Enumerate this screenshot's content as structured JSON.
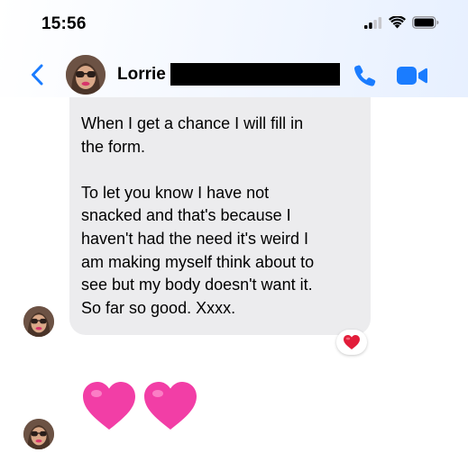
{
  "status_bar": {
    "time": "15:56",
    "icons": [
      "cellular-signal-icon",
      "wifi-icon",
      "battery-icon"
    ]
  },
  "header": {
    "back_icon": "chevron-left-icon",
    "contact_name": "Lorrie",
    "call_icon": "phone-icon",
    "video_icon": "video-camera-icon"
  },
  "messages": [
    {
      "sender": "Lorrie",
      "text": "When I get a chance I will fill in\nthe form.\n\nTo let you know I have not\nsnacked and that's because I\nhaven't had the need it's weird I\nam making myself think about  to\nsee but my body doesn't want it.\nSo far so good. Xxxx.",
      "reaction": "heart"
    },
    {
      "sender": "Lorrie",
      "emoji": "pink-hearts"
    }
  ],
  "colors": {
    "accent": "#1a7cff",
    "bubble": "#ececee",
    "heart_red": "#e21d3a",
    "heart_pink": "#f23ea6"
  }
}
